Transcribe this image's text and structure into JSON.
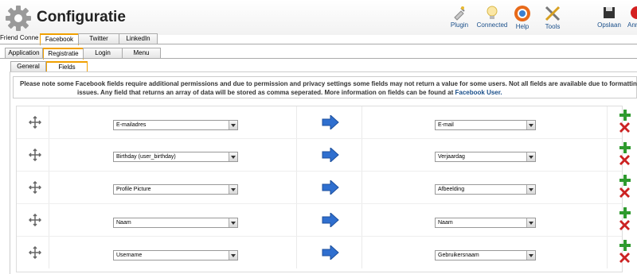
{
  "header": {
    "title": "Configuratie",
    "toolbar": [
      {
        "label": "Plugin",
        "icon": "plugin-icon"
      },
      {
        "label": "Connected",
        "icon": "connected-icon"
      },
      {
        "label": "Help",
        "icon": "help-icon"
      },
      {
        "label": "Tools",
        "icon": "tools-icon"
      },
      {
        "label": "Opslaan",
        "icon": "save-icon"
      },
      {
        "label": "Annuleren",
        "icon": "cancel-icon"
      }
    ]
  },
  "tabs_l1": [
    "Friend Connect",
    "Facebook",
    "Twitter",
    "LinkedIn"
  ],
  "tabs_l2": [
    "Application",
    "Registratie",
    "Login",
    "Menu"
  ],
  "tabs_l3": [
    "General",
    "Fields"
  ],
  "notice": {
    "line1": "Please note some Facebook fields require additional permissions and due to permission and privacy settings some fields may not return a value for some users. Not all fields are available due to formatting",
    "line2": "issues. Any field that returns an array of data will be stored as comma seperated. More information on fields can be found at",
    "link": "Facebook User."
  },
  "mappings": [
    {
      "facebook_field": "E-mailadres",
      "local_field": "E-mail"
    },
    {
      "facebook_field": "Birthday (user_birthday)",
      "local_field": "Verjaardag"
    },
    {
      "facebook_field": "Profile Picture",
      "local_field": "Afbeelding"
    },
    {
      "facebook_field": "Naam",
      "local_field": "Naam"
    },
    {
      "facebook_field": "Username",
      "local_field": "Gebruikersnaam"
    }
  ],
  "colors": {
    "active_tab": "#f0a000",
    "link": "#1a4f8a",
    "arrow": "#2f6fcf",
    "add": "#2e9a2e",
    "delete": "#cc2222"
  }
}
